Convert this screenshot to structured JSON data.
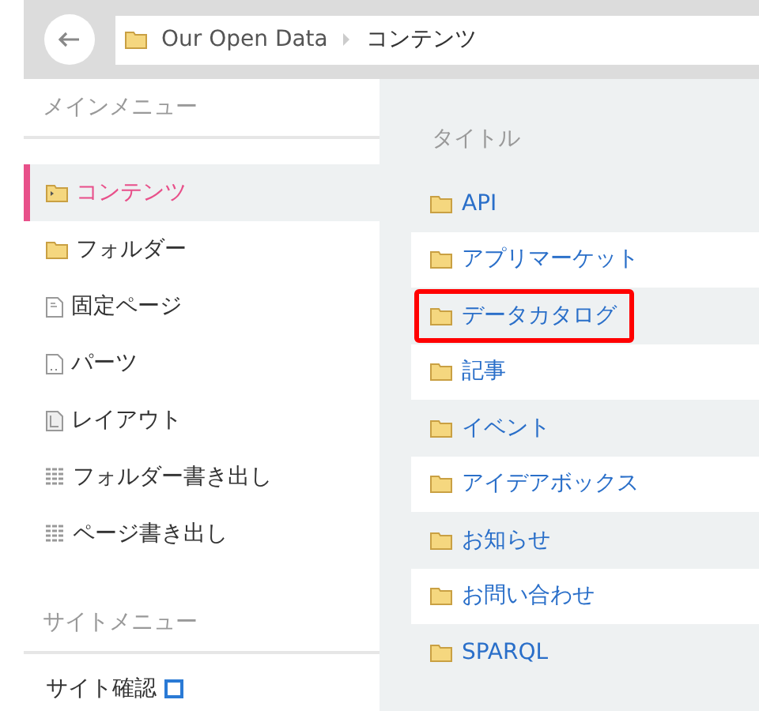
{
  "breadcrumb": {
    "items": [
      "Our Open Data",
      "コンテンツ"
    ]
  },
  "sidebar": {
    "sections": [
      {
        "title": "メインメニュー",
        "items": [
          {
            "label": "コンテンツ",
            "kind": "content",
            "selected": true
          },
          {
            "label": "フォルダー",
            "kind": "folder",
            "selected": false
          },
          {
            "label": "固定ページ",
            "kind": "page",
            "selected": false
          },
          {
            "label": "パーツ",
            "kind": "parts",
            "selected": false
          },
          {
            "label": "レイアウト",
            "kind": "layout",
            "selected": false
          },
          {
            "label": "フォルダー書き出し",
            "kind": "grid",
            "selected": false
          },
          {
            "label": "ページ書き出し",
            "kind": "grid",
            "selected": false
          }
        ]
      },
      {
        "title": "サイトメニュー",
        "items": [
          {
            "label": "サイト確認",
            "kind": "external",
            "selected": false
          }
        ]
      }
    ]
  },
  "table": {
    "column": "タイトル",
    "rows": [
      {
        "title": "API",
        "highlighted": false
      },
      {
        "title": "アプリマーケット",
        "highlighted": false
      },
      {
        "title": "データカタログ",
        "highlighted": true
      },
      {
        "title": "記事",
        "highlighted": false
      },
      {
        "title": "イベント",
        "highlighted": false
      },
      {
        "title": "アイデアボックス",
        "highlighted": false
      },
      {
        "title": "お知らせ",
        "highlighted": false
      },
      {
        "title": "お問い合わせ",
        "highlighted": false
      },
      {
        "title": "SPARQL",
        "highlighted": false
      }
    ]
  }
}
